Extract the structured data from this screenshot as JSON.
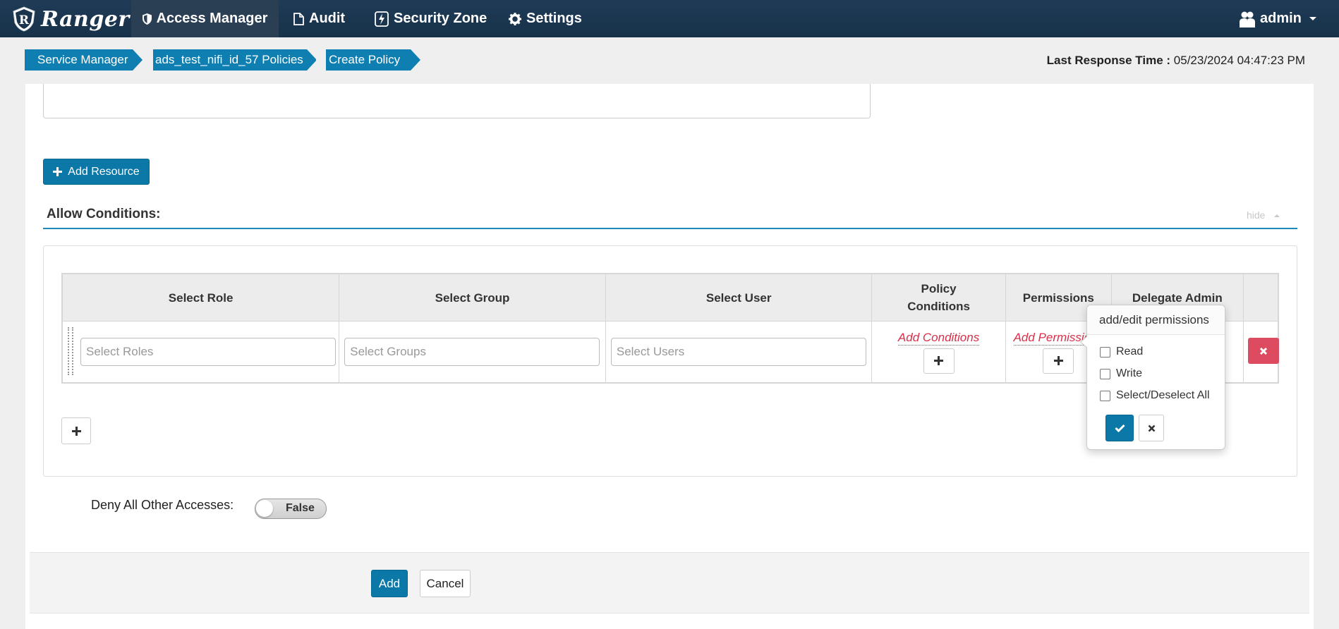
{
  "app": {
    "brand": "Ranger"
  },
  "nav": {
    "items": [
      {
        "label": "Access Manager",
        "icon": "shield-icon",
        "active": true
      },
      {
        "label": "Audit",
        "icon": "file-icon"
      },
      {
        "label": "Security Zone",
        "icon": "bolt-icon"
      },
      {
        "label": "Settings",
        "icon": "gear-icon"
      }
    ],
    "user": {
      "label": "admin",
      "icon": "users-icon"
    }
  },
  "breadcrumb": [
    {
      "label": "Service Manager"
    },
    {
      "label": "ads_test_nifi_id_57 Policies"
    },
    {
      "label": "Create Policy"
    }
  ],
  "last_response": {
    "label": "Last Response Time :",
    "value": "05/23/2024 04:47:23 PM"
  },
  "add_resource_label": "Add Resource",
  "allow_conditions": {
    "title": "Allow Conditions:",
    "hide_label": "hide",
    "columns": [
      "Select Role",
      "Select Group",
      "Select User",
      "Policy Conditions",
      "Permissions",
      "Delegate Admin",
      ""
    ],
    "row": {
      "role_placeholder": "Select Roles",
      "group_placeholder": "Select Groups",
      "user_placeholder": "Select Users",
      "add_conditions_label": "Add Conditions",
      "add_permissions_label": "Add Permissions"
    }
  },
  "popover": {
    "title": "add/edit permissions",
    "options": [
      "Read",
      "Write",
      "Select/Deselect All"
    ]
  },
  "deny_all": {
    "label": "Deny All Other Accesses:",
    "value": "False"
  },
  "actions": {
    "add_label": "Add",
    "cancel_label": "Cancel"
  },
  "colors": {
    "nav_bg": "#1a344e",
    "accent": "#0b78a8",
    "danger": "#dc4b5f",
    "link_red": "#d9304a"
  }
}
